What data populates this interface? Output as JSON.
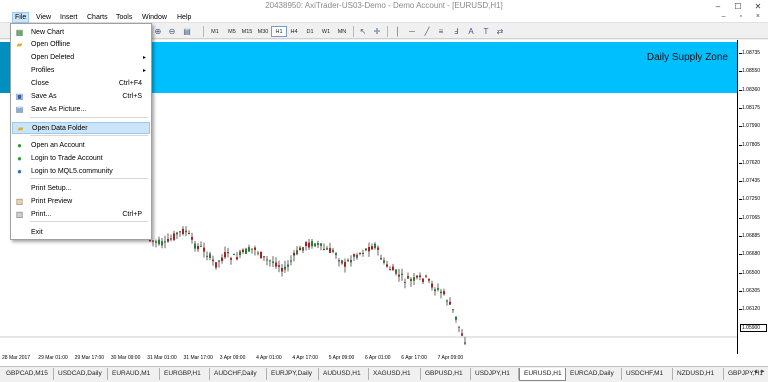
{
  "window": {
    "title": "20438950: AxiTrader-US03-Demo - Demo Account - [EURUSD,H1]",
    "controls": [
      "–",
      "☐",
      "✕"
    ]
  },
  "menu": {
    "items": [
      "File",
      "View",
      "Insert",
      "Charts",
      "Tools",
      "Window",
      "Help"
    ],
    "active": "File",
    "mdi_controls": "– ▫ ×"
  },
  "toolbar": {
    "periods": [
      "M1",
      "M5",
      "M15",
      "M30",
      "H1",
      "H4",
      "D1",
      "W1",
      "MN"
    ],
    "selected_period": "H1"
  },
  "file_menu": {
    "items": [
      {
        "label": "New Chart",
        "shortcut": "",
        "submenu": false,
        "icon": "new-chart-icon",
        "glyph": "▦",
        "color": "#2e7d32"
      },
      {
        "label": "Open Offline",
        "shortcut": "",
        "submenu": false,
        "icon": "folder-icon",
        "glyph": "▰",
        "color": "#e0b030"
      },
      {
        "label": "Open Deleted",
        "shortcut": "",
        "submenu": true,
        "icon": "",
        "glyph": "",
        "color": ""
      },
      {
        "label": "Profiles",
        "shortcut": "",
        "submenu": true,
        "icon": "",
        "glyph": "",
        "color": ""
      },
      {
        "label": "Close",
        "shortcut": "Ctrl+F4",
        "submenu": false,
        "icon": "",
        "glyph": "",
        "color": ""
      },
      {
        "label": "Save As",
        "shortcut": "Ctrl+S",
        "submenu": false,
        "icon": "save-icon",
        "glyph": "▣",
        "color": "#3060a0"
      },
      {
        "label": "Save As Picture...",
        "shortcut": "",
        "submenu": false,
        "icon": "picture-icon",
        "glyph": "▤",
        "color": "#3060a0"
      },
      {
        "label": "Open Data Folder",
        "shortcut": "",
        "submenu": false,
        "icon": "folder-icon",
        "glyph": "▰",
        "color": "#e0b030"
      },
      {
        "label": "Open an Account",
        "shortcut": "",
        "submenu": false,
        "icon": "account-icon",
        "glyph": "●",
        "color": "#3a9a3a"
      },
      {
        "label": "Login to Trade Account",
        "shortcut": "",
        "submenu": false,
        "icon": "login-icon",
        "glyph": "●",
        "color": "#3a9a3a"
      },
      {
        "label": "Login to MQL5.community",
        "shortcut": "",
        "submenu": false,
        "icon": "mql5-icon",
        "glyph": "●",
        "color": "#2a70c0"
      },
      {
        "label": "Print Setup...",
        "shortcut": "",
        "submenu": false,
        "icon": "",
        "glyph": "",
        "color": ""
      },
      {
        "label": "Print Preview",
        "shortcut": "",
        "submenu": false,
        "icon": "print-preview-icon",
        "glyph": "▥",
        "color": "#a08040"
      },
      {
        "label": "Print...",
        "shortcut": "Ctrl+P",
        "submenu": false,
        "icon": "print-icon",
        "glyph": "▥",
        "color": "#707070"
      },
      {
        "label": "Exit",
        "shortcut": "",
        "submenu": false,
        "icon": "",
        "glyph": "",
        "color": ""
      }
    ],
    "highlighted": "Open Data Folder"
  },
  "chart": {
    "zone_label": "Daily Supply Zone",
    "zone_color": "#00bfff",
    "current_price": "1.05900",
    "price_labels": [
      "1.08735",
      "1.08550",
      "1.08360",
      "1.08175",
      "1.07990",
      "1.07805",
      "1.07620",
      "1.07435",
      "1.07250",
      "1.07065",
      "1.06885",
      "1.06680",
      "1.06500",
      "1.06305",
      "1.06120",
      "1.05900"
    ],
    "time_labels": [
      "28 Mar 2017",
      "29 Mar 01:00",
      "29 Mar 17:00",
      "30 Mar 09:00",
      "31 Mar 01:00",
      "31 Mar 17:00",
      "3 Apr 09:00",
      "4 Apr 01:00",
      "4 Apr 17:00",
      "5 Apr 09:00",
      "6 Apr 01:00",
      "6 Apr 17:00",
      "7 Apr 09:00"
    ],
    "bull_color": "#2e7d32",
    "bear_color": "#b71c1c"
  },
  "tabs": {
    "items": [
      "GBPCAD,M15",
      "USDCAD,Daily",
      "EURAUD,M1",
      "EURGBP,H1",
      "AUDCHF,Daily",
      "EURJPY,Daily",
      "AUDUSD,H1",
      "XAGUSD,H1",
      "GBPUSD,H1",
      "USDJPY,H1",
      "EURUSD,H1",
      "EURCAD,Daily",
      "USDCHF,M1",
      "NZDUSD,H1",
      "GBPJPY,H1"
    ],
    "active": "EURUSD,H1",
    "scroll": "◄ ►"
  }
}
